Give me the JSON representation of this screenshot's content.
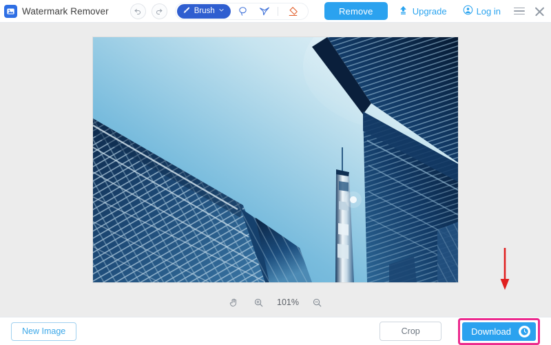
{
  "app": {
    "title": "Watermark Remover",
    "logo_icon": "photo-icon"
  },
  "header": {
    "undo_icon": "undo-arrow-icon",
    "redo_icon": "redo-arrow-icon",
    "tools": {
      "brush": {
        "label": "Brush",
        "icon": "brush-icon",
        "chevron": "chevron-down-icon",
        "active": true
      },
      "lasso": {
        "label": "Lasso",
        "icon": "lasso-icon"
      },
      "polygon": {
        "label": "Polygonal Lasso",
        "icon": "polygon-lasso-icon"
      },
      "eraser": {
        "label": "Eraser",
        "icon": "eraser-icon"
      }
    },
    "remove_label": "Remove",
    "upgrade_label": "Upgrade",
    "upgrade_icon": "upload-upgrade-icon",
    "login_label": "Log in",
    "login_icon": "user-avatar-icon",
    "menu_icon": "hamburger-menu-icon",
    "close_icon": "close-icon"
  },
  "canvas": {
    "image_name": "skyscrapers-looking-up",
    "background_color": "#ececec"
  },
  "zoombar": {
    "hand_icon": "hand-pan-icon",
    "zoom_in_icon": "zoom-in-icon",
    "zoom_out_icon": "zoom-out-icon",
    "zoom_level": "101%"
  },
  "footer": {
    "new_image_label": "New Image",
    "crop_label": "Crop",
    "download_label": "Download",
    "download_icon": "clock-icon"
  },
  "annotation": {
    "arrow_icon": "red-down-arrow-icon",
    "arrow_color": "#e02020",
    "highlight_color": "#ec2a8e"
  },
  "colors": {
    "primary_blue": "#2ba2ef",
    "brush_blue": "#2f5ed0",
    "link_blue": "#29a3ef",
    "eraser_orange": "#e2622f",
    "highlight_pink": "#ec2a8e"
  }
}
